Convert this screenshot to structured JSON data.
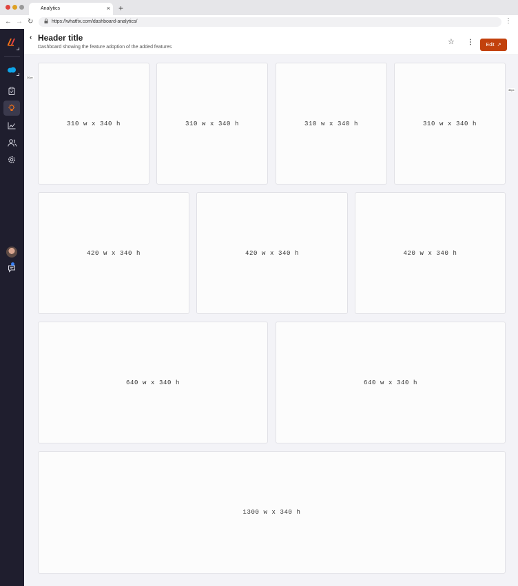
{
  "browser": {
    "tab_title": "Analytics",
    "tab_close": "×",
    "new_tab": "+",
    "url": "https://whatfix.com/dashboard-analytics/",
    "back": "←",
    "forward": "→",
    "reload": "↻",
    "menu": "⋮"
  },
  "sidebar": {
    "logo_icon": "whatfix-logo-icon",
    "items": [
      {
        "icon": "salesforce-cloud-icon"
      },
      {
        "icon": "clipboard-icon"
      },
      {
        "icon": "lightbulb-icon",
        "active": true
      },
      {
        "icon": "chart-icon"
      },
      {
        "icon": "users-icon"
      },
      {
        "icon": "settings-icon"
      }
    ],
    "avatar_icon": "user-avatar",
    "chat_icon": "chat-icon"
  },
  "header": {
    "back_icon": "‹",
    "title": "Header title",
    "subtitle": "Dashboard showing the feature adoption of the added features",
    "star_icon": "☆",
    "more_icon": "⋮",
    "edit_label": "Edit",
    "edit_icon": "↗",
    "edit_color": "#c2410c"
  },
  "annotations": {
    "left_spacing": "30px",
    "right_spacing": "36px"
  },
  "cards": [
    {
      "label": "310 w x 340 h"
    },
    {
      "label": "310 w x 340 h"
    },
    {
      "label": "310 w x 340 h"
    },
    {
      "label": "310 w x 340 h"
    },
    {
      "label": "420 w x 340 h"
    },
    {
      "label": "420 w x 340 h"
    },
    {
      "label": "420 w x 340 h"
    },
    {
      "label": "640 w x 340 h"
    },
    {
      "label": "640 w x 340 h"
    },
    {
      "label": "1300 w x 340 h"
    }
  ]
}
